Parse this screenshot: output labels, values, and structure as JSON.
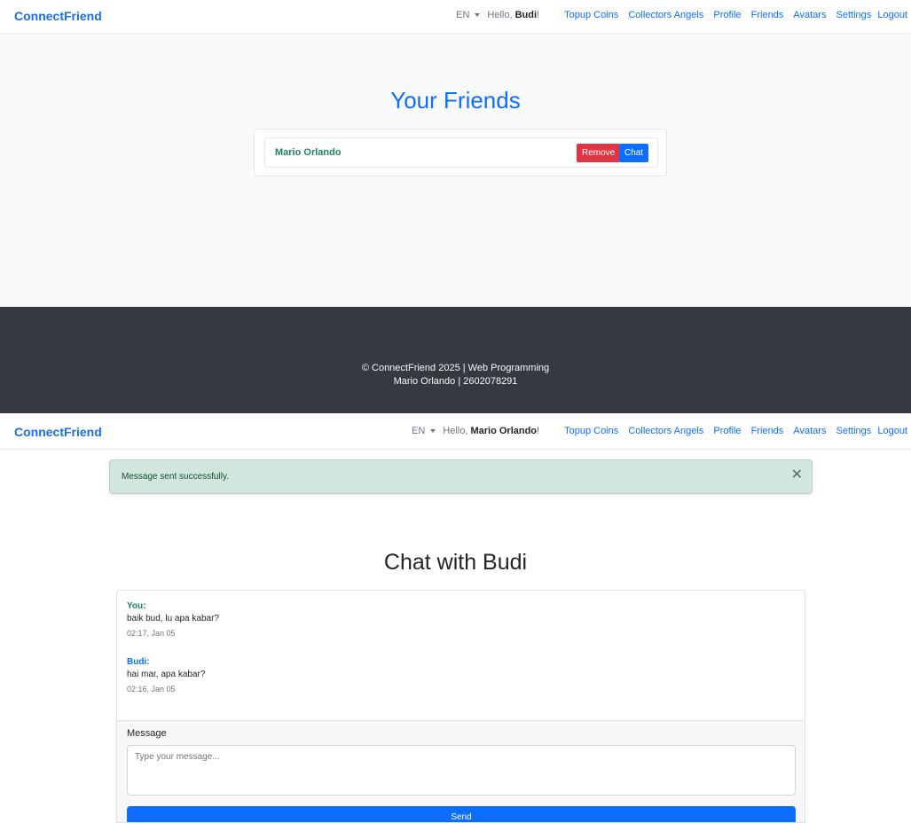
{
  "top_page": {
    "navbar": {
      "brand": "ConnectFriend",
      "language": "EN",
      "greeting_prefix": "Hello, ",
      "user_name": "Budi",
      "greeting_suffix": "!",
      "links": [
        "Topup Coins",
        "Collectors Angels",
        "Profile",
        "Friends",
        "Avatars",
        "Settings",
        "Logout"
      ]
    },
    "title": "Your Friends",
    "friends": [
      {
        "name": "Mario Orlando",
        "remove_label": "Remove",
        "chat_label": "Chat"
      }
    ],
    "footer": {
      "line1": "© ConnectFriend 2025 | Web Programming",
      "line2": "Mario Orlando | 2602078291"
    }
  },
  "bottom_page": {
    "navbar": {
      "brand": "ConnectFriend",
      "language": "EN",
      "greeting_prefix": "Hello, ",
      "user_name": "Mario Orlando",
      "greeting_suffix": "!",
      "links": [
        "Topup Coins",
        "Collectors Angels",
        "Profile",
        "Friends",
        "Avatars",
        "Settings",
        "Logout"
      ]
    },
    "alert": {
      "text": "Message sent successfully.",
      "close_icon": "close-icon"
    },
    "chat_title": "Chat with Budi",
    "messages": [
      {
        "sender": "You:",
        "text": "baik bud, lu apa kabar?",
        "time": "02:17, Jan 05"
      },
      {
        "sender": "Budi:",
        "text": "hai mar, apa kabar?",
        "time": "02:16, Jan 05"
      }
    ],
    "compose": {
      "label": "Message",
      "placeholder": "Type your message...",
      "value": "",
      "send_label": "Send"
    }
  },
  "colors": {
    "brand": "#1a6fe8",
    "primary": "#0d6efd",
    "danger": "#dc3545",
    "success": "#198754",
    "footer_bg": "#343a40",
    "alert_bg": "#d1e7dd"
  }
}
